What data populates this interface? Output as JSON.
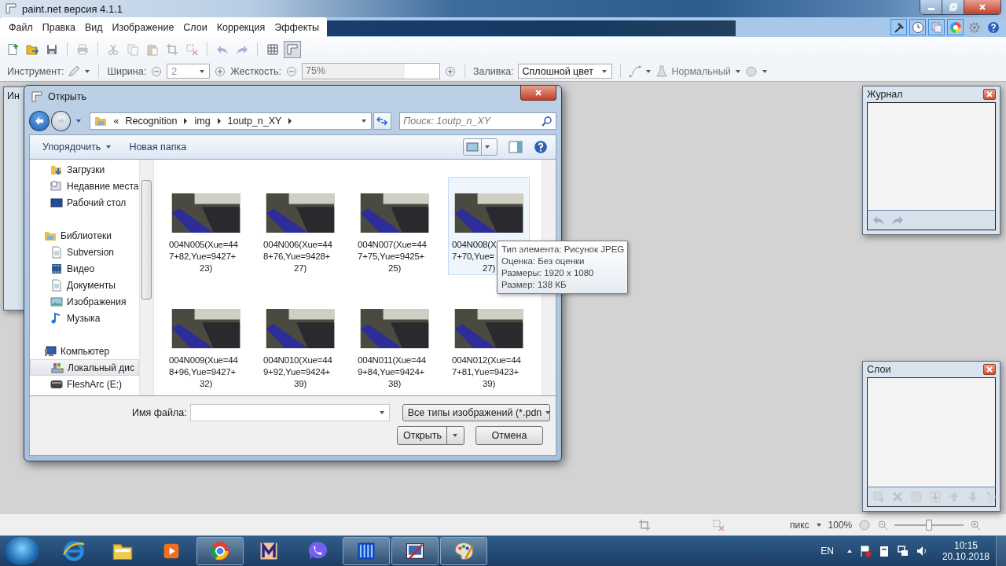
{
  "app": {
    "title": "paint.net версия 4.1.1"
  },
  "menu": [
    "Файл",
    "Правка",
    "Вид",
    "Изображение",
    "Слои",
    "Коррекция",
    "Эффекты"
  ],
  "panel_toggles": [
    {
      "kind": "tools",
      "selected": true
    },
    {
      "kind": "history",
      "selected": true
    },
    {
      "kind": "layers",
      "selected": true
    },
    {
      "kind": "colors",
      "selected": true
    },
    {
      "kind": "settings",
      "selected": false
    },
    {
      "kind": "help",
      "selected": false
    }
  ],
  "toolbar": [
    {
      "kind": "new",
      "disabled": false
    },
    {
      "kind": "open",
      "disabled": false
    },
    {
      "kind": "save",
      "disabled": false
    },
    {
      "kind": "separator"
    },
    {
      "kind": "print",
      "disabled": true
    },
    {
      "kind": "separator"
    },
    {
      "kind": "cut",
      "disabled": true
    },
    {
      "kind": "copy",
      "disabled": true
    },
    {
      "kind": "paste",
      "disabled": true
    },
    {
      "kind": "crop",
      "disabled": true
    },
    {
      "kind": "deselect",
      "disabled": true
    },
    {
      "kind": "separator"
    },
    {
      "kind": "undo",
      "disabled": true
    },
    {
      "kind": "redo",
      "disabled": true
    },
    {
      "kind": "separator"
    },
    {
      "kind": "grid",
      "disabled": false,
      "selected": false
    },
    {
      "kind": "rulers",
      "disabled": false,
      "selected": true
    }
  ],
  "options": {
    "tool_label": "Инструмент:",
    "width_label": "Ширина:",
    "width_value": "2",
    "hardness": {
      "label": "Жесткость:",
      "reading": "75%",
      "level": 0.75
    },
    "fill_label": "Заливка:",
    "fill_value": "Сплошной цвет",
    "blend_value": "Нормальный"
  },
  "tools_panel": {
    "title": "Ин"
  },
  "history_panel": {
    "title": "Журнал",
    "buttons": [
      {
        "kind": "undo",
        "disabled": true
      },
      {
        "kind": "redo",
        "disabled": true
      }
    ]
  },
  "layers_panel": {
    "title": "Слои",
    "buttons": [
      {
        "kind": "add",
        "disabled": true
      },
      {
        "kind": "delete",
        "disabled": true
      },
      {
        "kind": "duplicate",
        "disabled": true
      },
      {
        "kind": "merge",
        "disabled": true
      },
      {
        "kind": "up",
        "disabled": true
      },
      {
        "kind": "down",
        "disabled": true
      },
      {
        "kind": "properties",
        "disabled": true
      }
    ]
  },
  "dialog": {
    "title": "Открыть",
    "breadcrumb_overflow": "«",
    "path": [
      "Recognition",
      "img",
      "1outp_n_XY"
    ],
    "search_placeholder": "Поиск: 1outp_n_XY",
    "organize": "Упорядочить",
    "new_folder": "Новая папка",
    "nav_groups": [
      {
        "children": [
          {
            "label": "Загрузки",
            "kind": "downloads",
            "selected": false
          },
          {
            "label": "Недавние места",
            "kind": "recent",
            "selected": false
          },
          {
            "label": "Рабочий стол",
            "kind": "desktop",
            "selected": false
          }
        ]
      },
      {
        "label": "Библиотеки",
        "kind": "library",
        "selected": false,
        "children": [
          {
            "label": "Subversion",
            "kind": "document",
            "selected": false
          },
          {
            "label": "Видео",
            "kind": "video",
            "selected": false
          },
          {
            "label": "Документы",
            "kind": "document",
            "selected": false
          },
          {
            "label": "Изображения",
            "kind": "pictures",
            "selected": false
          },
          {
            "label": "Музыка",
            "kind": "music",
            "selected": false
          }
        ]
      },
      {
        "label": "Компьютер",
        "kind": "computer",
        "selected": false,
        "children": [
          {
            "label": "Локальный дис",
            "kind": "drive",
            "selected": true
          },
          {
            "label": "FleshArc (E:)",
            "kind": "usb",
            "selected": false
          }
        ]
      }
    ],
    "files": [
      {
        "lines": [
          "004N005(Xue=44",
          "7+82,Yue=9427+",
          "23)"
        ],
        "selected": false
      },
      {
        "lines": [
          "004N006(Xue=44",
          "8+76,Yue=9428+",
          "27)"
        ],
        "selected": false
      },
      {
        "lines": [
          "004N007(Xue=44",
          "7+75,Yue=9425+",
          "25)"
        ],
        "selected": false
      },
      {
        "lines": [
          "004N008(X",
          "7+70,Yue=",
          "27)"
        ],
        "selected": true
      },
      {
        "lines": [
          "004N009(Xue=44",
          "8+96,Yue=9427+",
          "32)"
        ],
        "selected": false
      },
      {
        "lines": [
          "004N010(Xue=44",
          "9+92,Yue=9424+",
          "39)"
        ],
        "selected": false
      },
      {
        "lines": [
          "004N011(Xue=44",
          "9+84,Yue=9424+",
          "38)"
        ],
        "selected": false
      },
      {
        "lines": [
          "004N012(Xue=44",
          "7+81,Yue=9423+",
          "39)"
        ],
        "selected": false
      }
    ],
    "tooltip": [
      "Тип элемента: Рисунок JPEG",
      "Оценка: Без оценки",
      "Размеры: 1920 x 1080",
      "Размер: 138 КБ"
    ],
    "file_name_label": "Имя файла:",
    "file_type": "Все типы изображений (*.pdn",
    "open_button": "Открыть",
    "cancel_button": "Отмена"
  },
  "status_bar": {
    "unit": "пикс",
    "zoom": "100%",
    "zoom_slider": {
      "level": 0.5
    }
  },
  "taskbar": {
    "apps": [
      {
        "kind": "browser",
        "running": false
      },
      {
        "kind": "folder",
        "running": false
      },
      {
        "kind": "media",
        "running": false
      },
      {
        "kind": "round",
        "running": true
      },
      {
        "kind": "mapp",
        "running": false
      },
      {
        "kind": "phone",
        "running": false
      },
      {
        "kind": "server",
        "running": true
      },
      {
        "kind": "paintnet",
        "running": true
      },
      {
        "kind": "palette",
        "running": true
      }
    ],
    "language": "EN",
    "time": "10:15",
    "date": "20.10.2018"
  }
}
